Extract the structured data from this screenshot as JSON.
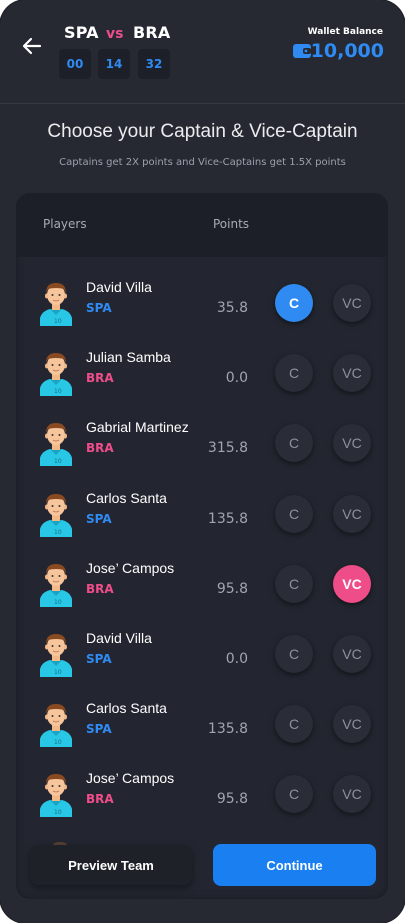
{
  "header": {
    "team_a": "SPA",
    "vs": "vs",
    "team_b": "BRA",
    "timer": [
      "00",
      "14",
      "32"
    ],
    "wallet_label": "Wallet Balance",
    "wallet_amount": "10,000"
  },
  "page": {
    "title": "Choose your Captain & Vice-Captain",
    "subtitle": "Captains get 2X points and Vice-Captains get 1.5X points"
  },
  "table": {
    "col_players": "Players",
    "col_points": "Points",
    "captain_label": "C",
    "vice_label": "VC",
    "players": [
      {
        "name": "David Villa",
        "team": "SPA",
        "points": "35.8",
        "captain": true,
        "vice": false
      },
      {
        "name": "Julian Samba",
        "team": "BRA",
        "points": "0.0",
        "captain": false,
        "vice": false
      },
      {
        "name": "Gabrial Martinez",
        "team": "BRA",
        "points": "315.8",
        "captain": false,
        "vice": false
      },
      {
        "name": "Carlos Santa",
        "team": "SPA",
        "points": "135.8",
        "captain": false,
        "vice": false
      },
      {
        "name": "Jose’ Campos",
        "team": "BRA",
        "points": "95.8",
        "captain": false,
        "vice": true
      },
      {
        "name": "David Villa",
        "team": "SPA",
        "points": "0.0",
        "captain": false,
        "vice": false
      },
      {
        "name": "Carlos Santa",
        "team": "SPA",
        "points": "135.8",
        "captain": false,
        "vice": false
      },
      {
        "name": "Jose’ Campos",
        "team": "BRA",
        "points": "95.8",
        "captain": false,
        "vice": false
      }
    ]
  },
  "actions": {
    "preview_label": "Preview Team",
    "continue_label": "Continue"
  },
  "colors": {
    "accent_blue": "#2f8bf2",
    "accent_pink": "#ef4d8a",
    "background": "#262932"
  },
  "icons": {
    "back": "arrow-left-icon",
    "wallet": "wallet-icon",
    "avatar": "player-avatar-icon"
  }
}
